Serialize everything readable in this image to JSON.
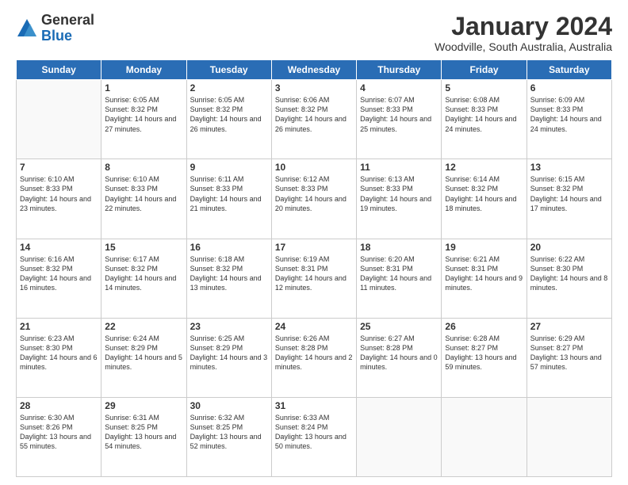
{
  "logo": {
    "general": "General",
    "blue": "Blue"
  },
  "header": {
    "month": "January 2024",
    "location": "Woodville, South Australia, Australia"
  },
  "days": [
    "Sunday",
    "Monday",
    "Tuesday",
    "Wednesday",
    "Thursday",
    "Friday",
    "Saturday"
  ],
  "weeks": [
    [
      {
        "num": "",
        "sunrise": "",
        "sunset": "",
        "daylight": ""
      },
      {
        "num": "1",
        "sunrise": "Sunrise: 6:05 AM",
        "sunset": "Sunset: 8:32 PM",
        "daylight": "Daylight: 14 hours and 27 minutes."
      },
      {
        "num": "2",
        "sunrise": "Sunrise: 6:05 AM",
        "sunset": "Sunset: 8:32 PM",
        "daylight": "Daylight: 14 hours and 26 minutes."
      },
      {
        "num": "3",
        "sunrise": "Sunrise: 6:06 AM",
        "sunset": "Sunset: 8:32 PM",
        "daylight": "Daylight: 14 hours and 26 minutes."
      },
      {
        "num": "4",
        "sunrise": "Sunrise: 6:07 AM",
        "sunset": "Sunset: 8:33 PM",
        "daylight": "Daylight: 14 hours and 25 minutes."
      },
      {
        "num": "5",
        "sunrise": "Sunrise: 6:08 AM",
        "sunset": "Sunset: 8:33 PM",
        "daylight": "Daylight: 14 hours and 24 minutes."
      },
      {
        "num": "6",
        "sunrise": "Sunrise: 6:09 AM",
        "sunset": "Sunset: 8:33 PM",
        "daylight": "Daylight: 14 hours and 24 minutes."
      }
    ],
    [
      {
        "num": "7",
        "sunrise": "Sunrise: 6:10 AM",
        "sunset": "Sunset: 8:33 PM",
        "daylight": "Daylight: 14 hours and 23 minutes."
      },
      {
        "num": "8",
        "sunrise": "Sunrise: 6:10 AM",
        "sunset": "Sunset: 8:33 PM",
        "daylight": "Daylight: 14 hours and 22 minutes."
      },
      {
        "num": "9",
        "sunrise": "Sunrise: 6:11 AM",
        "sunset": "Sunset: 8:33 PM",
        "daylight": "Daylight: 14 hours and 21 minutes."
      },
      {
        "num": "10",
        "sunrise": "Sunrise: 6:12 AM",
        "sunset": "Sunset: 8:33 PM",
        "daylight": "Daylight: 14 hours and 20 minutes."
      },
      {
        "num": "11",
        "sunrise": "Sunrise: 6:13 AM",
        "sunset": "Sunset: 8:33 PM",
        "daylight": "Daylight: 14 hours and 19 minutes."
      },
      {
        "num": "12",
        "sunrise": "Sunrise: 6:14 AM",
        "sunset": "Sunset: 8:32 PM",
        "daylight": "Daylight: 14 hours and 18 minutes."
      },
      {
        "num": "13",
        "sunrise": "Sunrise: 6:15 AM",
        "sunset": "Sunset: 8:32 PM",
        "daylight": "Daylight: 14 hours and 17 minutes."
      }
    ],
    [
      {
        "num": "14",
        "sunrise": "Sunrise: 6:16 AM",
        "sunset": "Sunset: 8:32 PM",
        "daylight": "Daylight: 14 hours and 16 minutes."
      },
      {
        "num": "15",
        "sunrise": "Sunrise: 6:17 AM",
        "sunset": "Sunset: 8:32 PM",
        "daylight": "Daylight: 14 hours and 14 minutes."
      },
      {
        "num": "16",
        "sunrise": "Sunrise: 6:18 AM",
        "sunset": "Sunset: 8:32 PM",
        "daylight": "Daylight: 14 hours and 13 minutes."
      },
      {
        "num": "17",
        "sunrise": "Sunrise: 6:19 AM",
        "sunset": "Sunset: 8:31 PM",
        "daylight": "Daylight: 14 hours and 12 minutes."
      },
      {
        "num": "18",
        "sunrise": "Sunrise: 6:20 AM",
        "sunset": "Sunset: 8:31 PM",
        "daylight": "Daylight: 14 hours and 11 minutes."
      },
      {
        "num": "19",
        "sunrise": "Sunrise: 6:21 AM",
        "sunset": "Sunset: 8:31 PM",
        "daylight": "Daylight: 14 hours and 9 minutes."
      },
      {
        "num": "20",
        "sunrise": "Sunrise: 6:22 AM",
        "sunset": "Sunset: 8:30 PM",
        "daylight": "Daylight: 14 hours and 8 minutes."
      }
    ],
    [
      {
        "num": "21",
        "sunrise": "Sunrise: 6:23 AM",
        "sunset": "Sunset: 8:30 PM",
        "daylight": "Daylight: 14 hours and 6 minutes."
      },
      {
        "num": "22",
        "sunrise": "Sunrise: 6:24 AM",
        "sunset": "Sunset: 8:29 PM",
        "daylight": "Daylight: 14 hours and 5 minutes."
      },
      {
        "num": "23",
        "sunrise": "Sunrise: 6:25 AM",
        "sunset": "Sunset: 8:29 PM",
        "daylight": "Daylight: 14 hours and 3 minutes."
      },
      {
        "num": "24",
        "sunrise": "Sunrise: 6:26 AM",
        "sunset": "Sunset: 8:28 PM",
        "daylight": "Daylight: 14 hours and 2 minutes."
      },
      {
        "num": "25",
        "sunrise": "Sunrise: 6:27 AM",
        "sunset": "Sunset: 8:28 PM",
        "daylight": "Daylight: 14 hours and 0 minutes."
      },
      {
        "num": "26",
        "sunrise": "Sunrise: 6:28 AM",
        "sunset": "Sunset: 8:27 PM",
        "daylight": "Daylight: 13 hours and 59 minutes."
      },
      {
        "num": "27",
        "sunrise": "Sunrise: 6:29 AM",
        "sunset": "Sunset: 8:27 PM",
        "daylight": "Daylight: 13 hours and 57 minutes."
      }
    ],
    [
      {
        "num": "28",
        "sunrise": "Sunrise: 6:30 AM",
        "sunset": "Sunset: 8:26 PM",
        "daylight": "Daylight: 13 hours and 55 minutes."
      },
      {
        "num": "29",
        "sunrise": "Sunrise: 6:31 AM",
        "sunset": "Sunset: 8:25 PM",
        "daylight": "Daylight: 13 hours and 54 minutes."
      },
      {
        "num": "30",
        "sunrise": "Sunrise: 6:32 AM",
        "sunset": "Sunset: 8:25 PM",
        "daylight": "Daylight: 13 hours and 52 minutes."
      },
      {
        "num": "31",
        "sunrise": "Sunrise: 6:33 AM",
        "sunset": "Sunset: 8:24 PM",
        "daylight": "Daylight: 13 hours and 50 minutes."
      },
      {
        "num": "",
        "sunrise": "",
        "sunset": "",
        "daylight": ""
      },
      {
        "num": "",
        "sunrise": "",
        "sunset": "",
        "daylight": ""
      },
      {
        "num": "",
        "sunrise": "",
        "sunset": "",
        "daylight": ""
      }
    ]
  ]
}
